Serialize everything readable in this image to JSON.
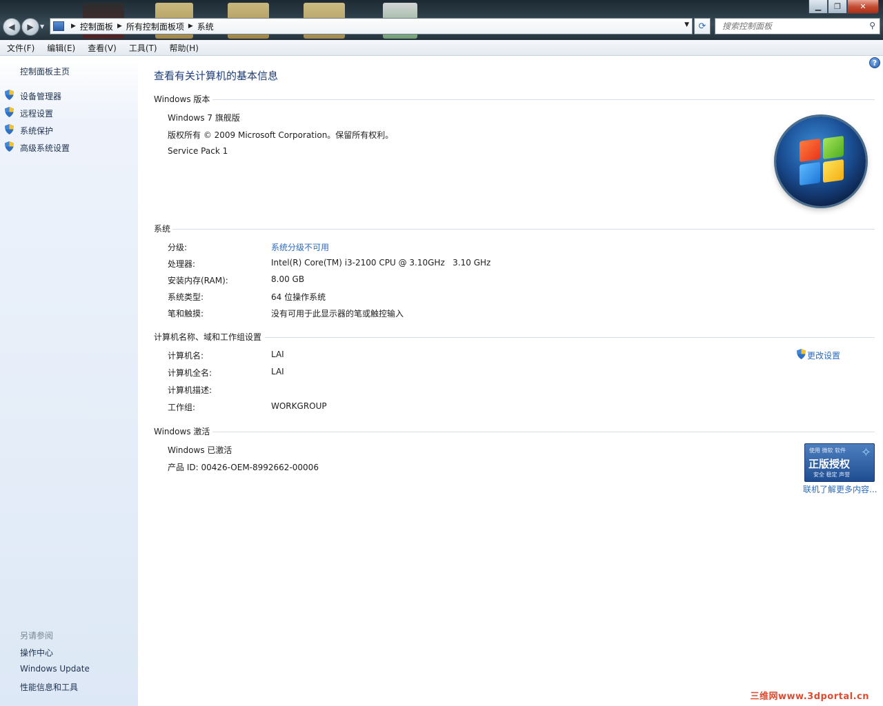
{
  "address_bar": {
    "breadcrumbs": [
      "控制面板",
      "所有控制面板项",
      "系统"
    ]
  },
  "search": {
    "placeholder": "搜索控制面板"
  },
  "menu": [
    "文件(F)",
    "编辑(E)",
    "查看(V)",
    "工具(T)",
    "帮助(H)"
  ],
  "sidebar": {
    "home": "控制面板主页",
    "tasks": [
      "设备管理器",
      "远程设置",
      "系统保护",
      "高级系统设置"
    ],
    "see_also_heading": "另请参阅",
    "see_also": [
      "操作中心",
      "Windows Update",
      "性能信息和工具"
    ]
  },
  "main": {
    "title": "查看有关计算机的基本信息",
    "edition": {
      "heading": "Windows 版本",
      "name": "Windows 7 旗舰版",
      "copyright": "版权所有 © 2009 Microsoft Corporation。保留所有权利。",
      "service_pack": "Service Pack 1"
    },
    "system": {
      "heading": "系统",
      "rows": [
        {
          "label": "分级:",
          "value": "系统分级不可用"
        },
        {
          "label": "处理器:",
          "value": "Intel(R) Core(TM) i3-2100 CPU @ 3.10GHz   3.10 GHz"
        },
        {
          "label": "安装内存(RAM):",
          "value": "8.00 GB"
        },
        {
          "label": "系统类型:",
          "value": "64 位操作系统"
        },
        {
          "label": "笔和触摸:",
          "value": "没有可用于此显示器的笔或触控输入"
        }
      ]
    },
    "computer": {
      "heading": "计算机名称、域和工作组设置",
      "change_settings": "更改设置",
      "rows": [
        {
          "label": "计算机名:",
          "value": "LAI"
        },
        {
          "label": "计算机全名:",
          "value": "LAI"
        },
        {
          "label": "计算机描述:",
          "value": ""
        },
        {
          "label": "工作组:",
          "value": "WORKGROUP"
        }
      ]
    },
    "activation": {
      "heading": "Windows 激活",
      "status": "Windows 已激活",
      "product_id": "产品 ID: 00426-OEM-8992662-00006",
      "badge_top": "使用 微软 软件",
      "badge_main": "正版授权",
      "badge_sub": "安全 稳定 声誉",
      "more_link": "联机了解更多内容..."
    }
  },
  "watermark": "三维网www.3dportal.cn"
}
